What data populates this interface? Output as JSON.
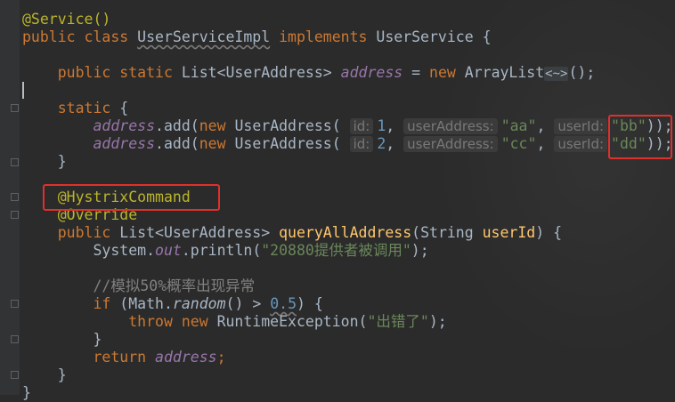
{
  "code": {
    "l1_annotation": "@Service()",
    "l2_public": "public",
    "l2_class": "class",
    "l2_classname": "UserServiceImpl",
    "l2_implements": "implements",
    "l2_interface": "UserService {",
    "l4_mods": "public static",
    "l4_type": "List<UserAddress>",
    "l4_field": "address",
    "l4_eq": "=",
    "l4_new": "new",
    "l4_ctor": "ArrayList",
    "l4_diamond": "<~>",
    "l4_end": "();",
    "l6_static": "static",
    "l6_brace": "{",
    "l7_field": "address",
    "l7_add": ".add(",
    "l7_new": "new",
    "l7_ctor": "UserAddress(",
    "l7_hint_id": "id:",
    "l7_id": "1",
    "l7_hint_addr": "userAddress:",
    "l7_addr": "\"aa\"",
    "l7_hint_uid": "userId:",
    "l7_uid": "\"bb\"",
    "l7_end": "));",
    "l8_field": "address",
    "l8_add": ".add(",
    "l8_new": "new",
    "l8_ctor": "UserAddress(",
    "l8_hint_id": "id:",
    "l8_id": "2",
    "l8_hint_addr": "userAddress:",
    "l8_addr": "\"cc\"",
    "l8_hint_uid": "userId:",
    "l8_uid": "\"dd\"",
    "l8_end": "));",
    "l9_close": "}",
    "l11_annotation": "@HystrixCommand",
    "l12_annotation": "@Override",
    "l13_public": "public",
    "l13_type": "List<UserAddress>",
    "l13_method": "queryAllAddress",
    "l13_paren": "(String",
    "l13_param": "userId",
    "l13_end": ") {",
    "l14_system": "System.",
    "l14_out": "out",
    "l14_println": ".println(",
    "l14_str": "\"20880提供者被调用\"",
    "l14_end": ");",
    "l16_comment": "//模拟50%概率出现异常",
    "l17_if": "if",
    "l17_math": "(Math.",
    "l17_random": "random",
    "l17_gt": "() >",
    "l17_num": "0.5",
    "l17_end": ") {",
    "l18_throw": "throw new",
    "l18_ctor": "RuntimeException(",
    "l18_str": "\"出错了\"",
    "l18_end": ");",
    "l19_close": "}",
    "l20_return": "return",
    "l20_field": "address",
    "l20_end": ";",
    "l21_close": "}",
    "l22_close": "}"
  },
  "colors": {
    "background": "#2b2b2b",
    "keyword": "#cc7832",
    "annotation": "#bbb529",
    "field": "#9876aa",
    "string": "#6a8759",
    "number": "#6897bb",
    "method": "#ffc66d",
    "comment": "#808080",
    "highlight_box": "#e0302b"
  }
}
